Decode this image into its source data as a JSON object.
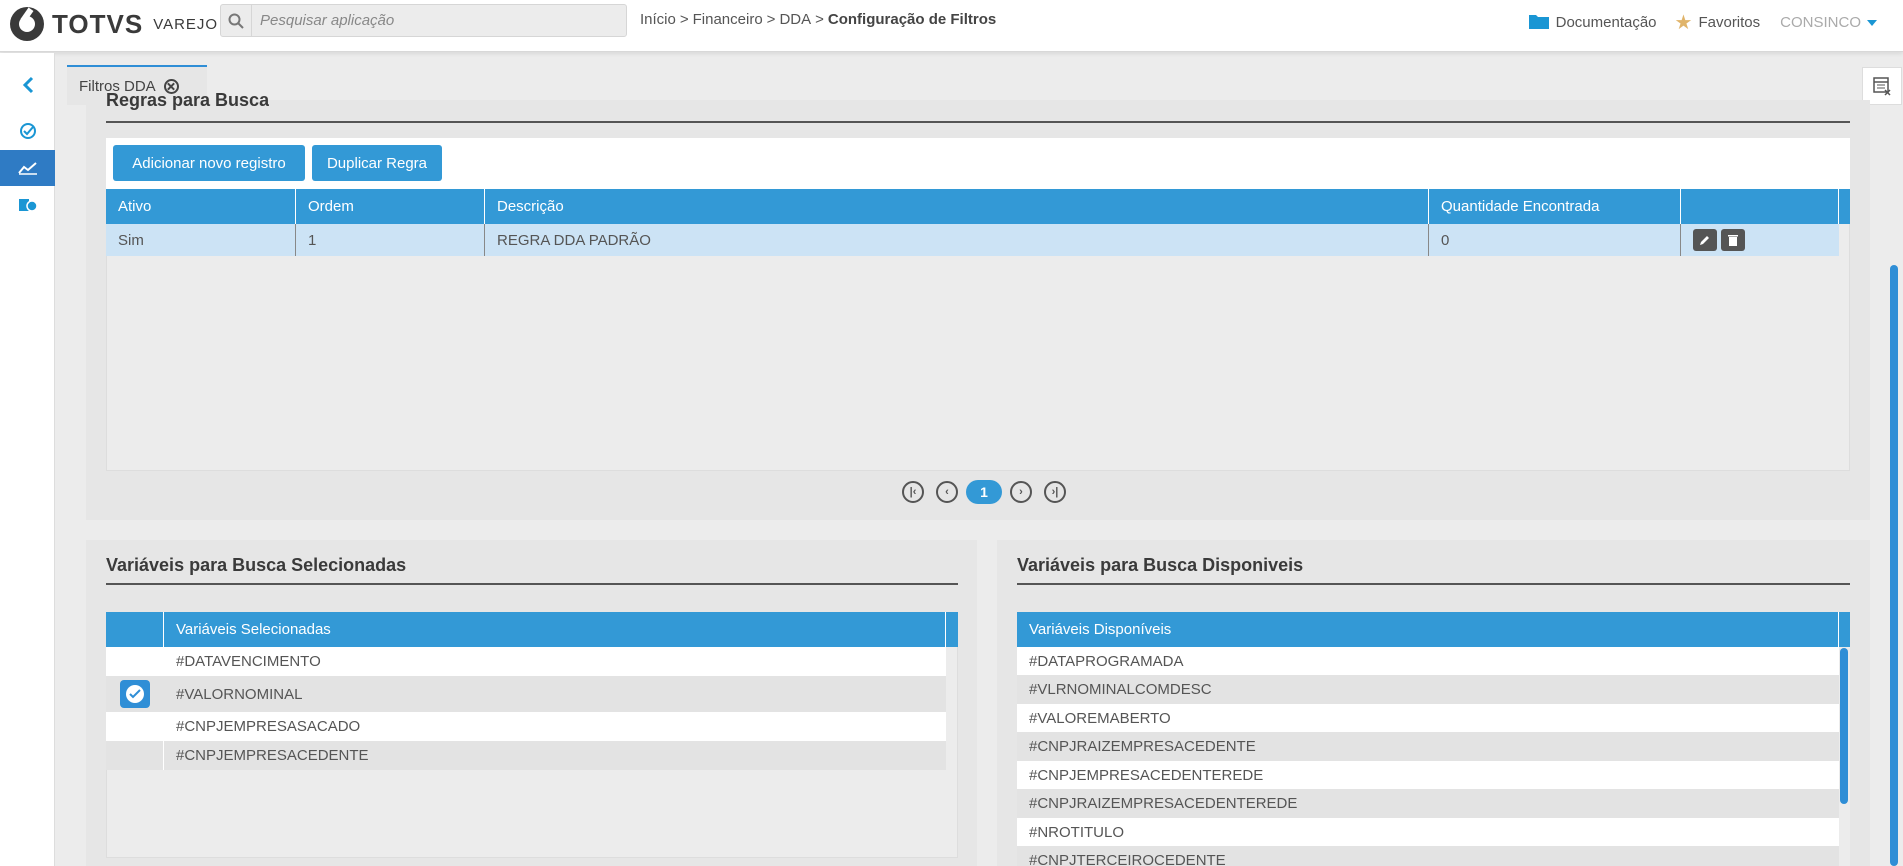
{
  "header": {
    "logo_text": "TOTVS",
    "logo_sub": "VAREJO",
    "search_placeholder": "Pesquisar aplicação",
    "breadcrumb": [
      "Início",
      "Financeiro",
      "DDA",
      "Configuração de Filtros"
    ],
    "breadcrumb_sep": ">",
    "documentation": "Documentação",
    "favorites": "Favoritos",
    "user": "CONSINCO"
  },
  "tab": {
    "label": "Filtros DDA"
  },
  "rules": {
    "title": "Regras para Busca",
    "add_button": "Adicionar novo registro",
    "duplicate_button": "Duplicar Regra",
    "columns": [
      "Ativo",
      "Ordem",
      "Descrição",
      "Quantidade Encontrada"
    ],
    "rows": [
      {
        "ativo": "Sim",
        "ordem": "1",
        "descricao": "REGRA DDA PADRÃO",
        "quantidade": "0"
      }
    ],
    "current_page": "1"
  },
  "selected": {
    "title": "Variáveis para Busca Selecionadas",
    "column": "Variáveis Selecionadas",
    "items": [
      "#DATAVENCIMENTO",
      "#VALORNOMINAL",
      "#CNPJEMPRESASACADO",
      "#CNPJEMPRESACEDENTE"
    ]
  },
  "available": {
    "title": "Variáveis para Busca Disponiveis",
    "column": "Variáveis Disponíveis",
    "items": [
      "#DATAPROGRAMADA",
      "#VLRNOMINALCOMDESC",
      "#VALOREMABERTO",
      "#CNPJRAIZEMPRESACEDENTE",
      "#CNPJEMPRESACEDENTEREDE",
      "#CNPJRAIZEMPRESACEDENTEREDE",
      "#NROTITULO",
      "#CNPJTERCEIROCEDENTE"
    ]
  },
  "colors": {
    "accent": "#3399d6",
    "selected_row": "#cce3f5",
    "sidebar_active": "#2f7bc4"
  }
}
